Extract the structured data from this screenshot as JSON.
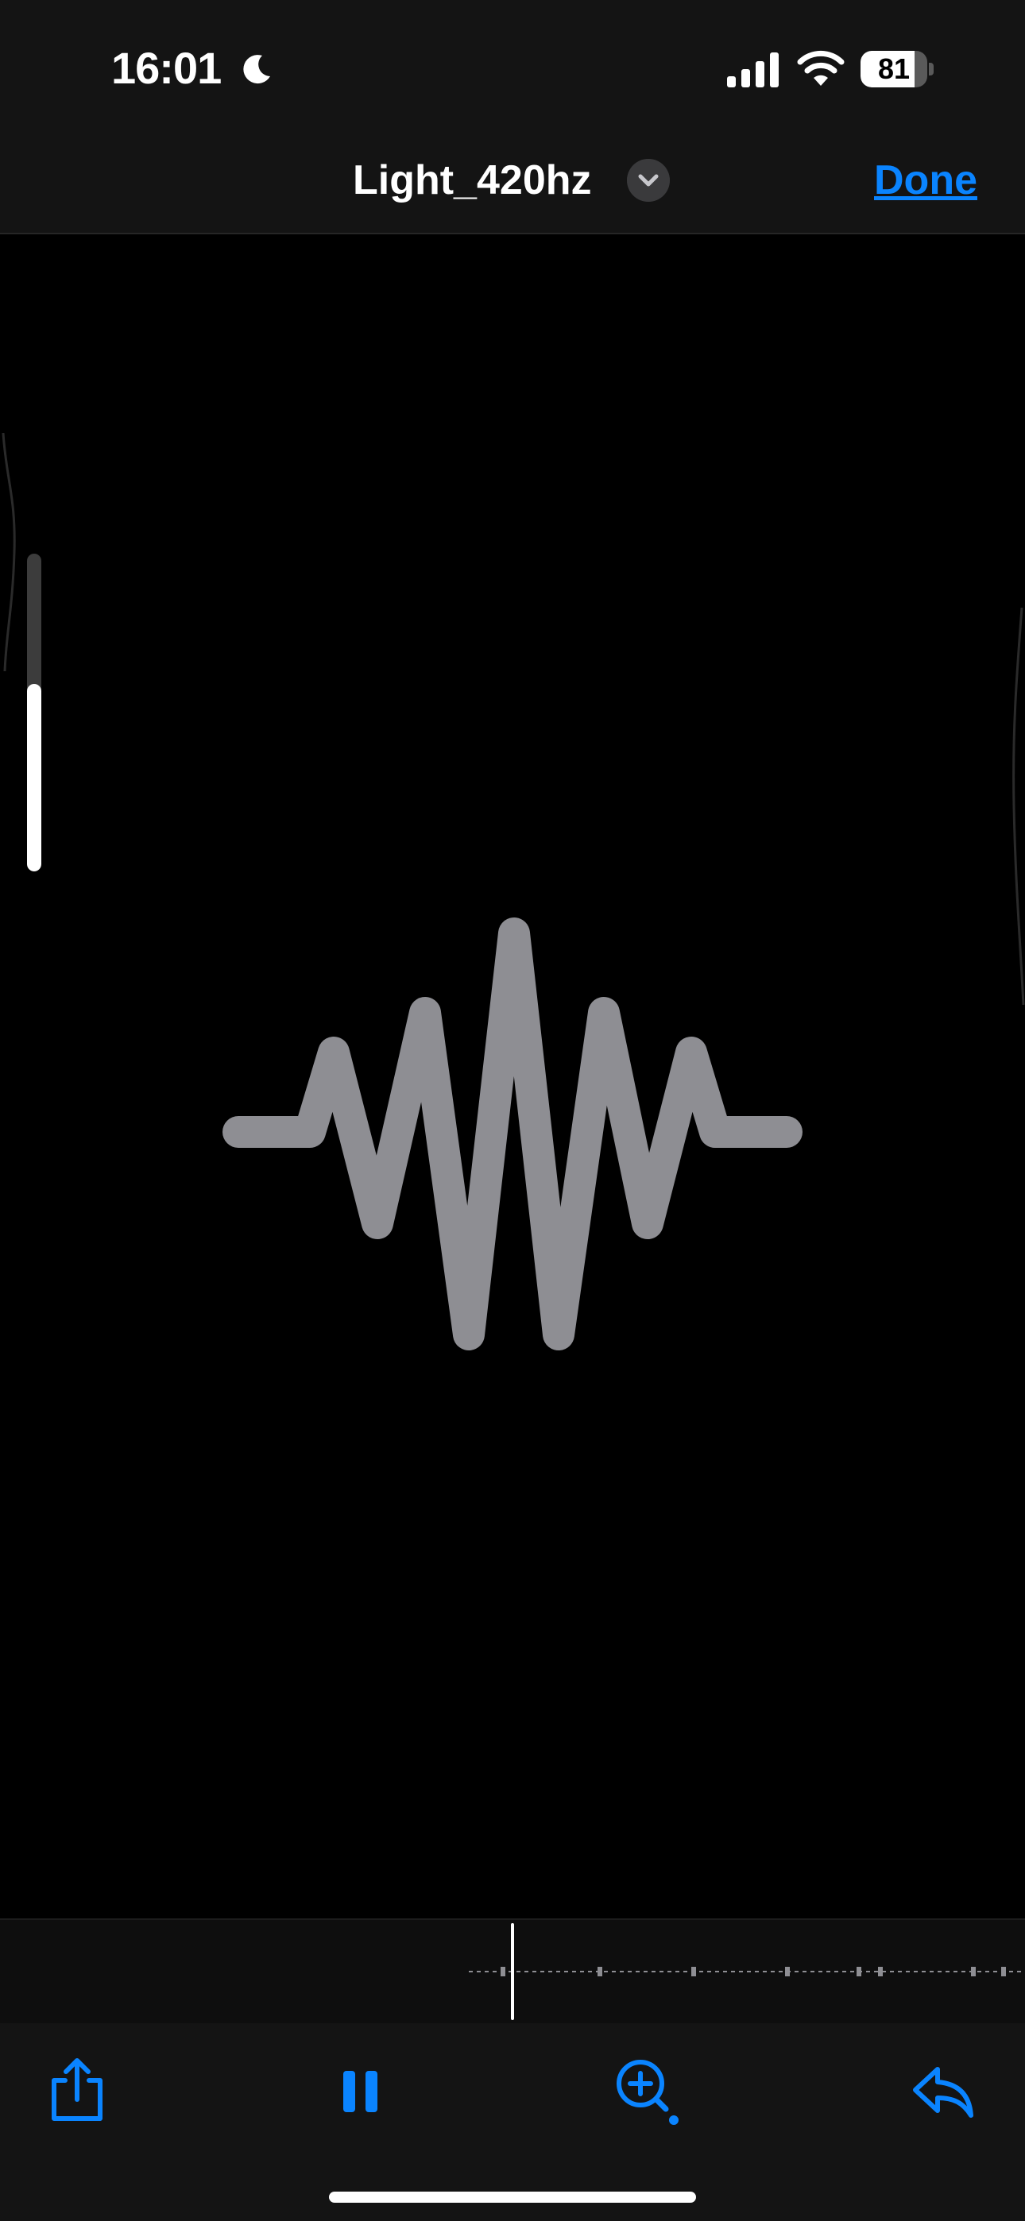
{
  "status_bar": {
    "time": "16:01",
    "battery_percent": "81",
    "battery_level": 0.81,
    "focus_icon": "moon-icon",
    "signal_icon": "cellular-signal-icon",
    "wifi_icon": "wifi-icon"
  },
  "header": {
    "title": "Light_420hz",
    "title_menu_icon": "chevron-down-icon",
    "done_label": "Done"
  },
  "viewer": {
    "content_icon": "waveform-icon",
    "volume_level": 0.59,
    "icon_color": "#8e8e93"
  },
  "timeline": {
    "playhead_icon": "playhead"
  },
  "toolbar": {
    "share_icon": "share-icon",
    "pause_icon": "pause-icon",
    "zoom_icon": "zoom-in-icon",
    "reply_icon": "reply-icon"
  },
  "colors": {
    "accent": "#0a84ff",
    "background": "#000000",
    "bar_background": "#141414"
  }
}
